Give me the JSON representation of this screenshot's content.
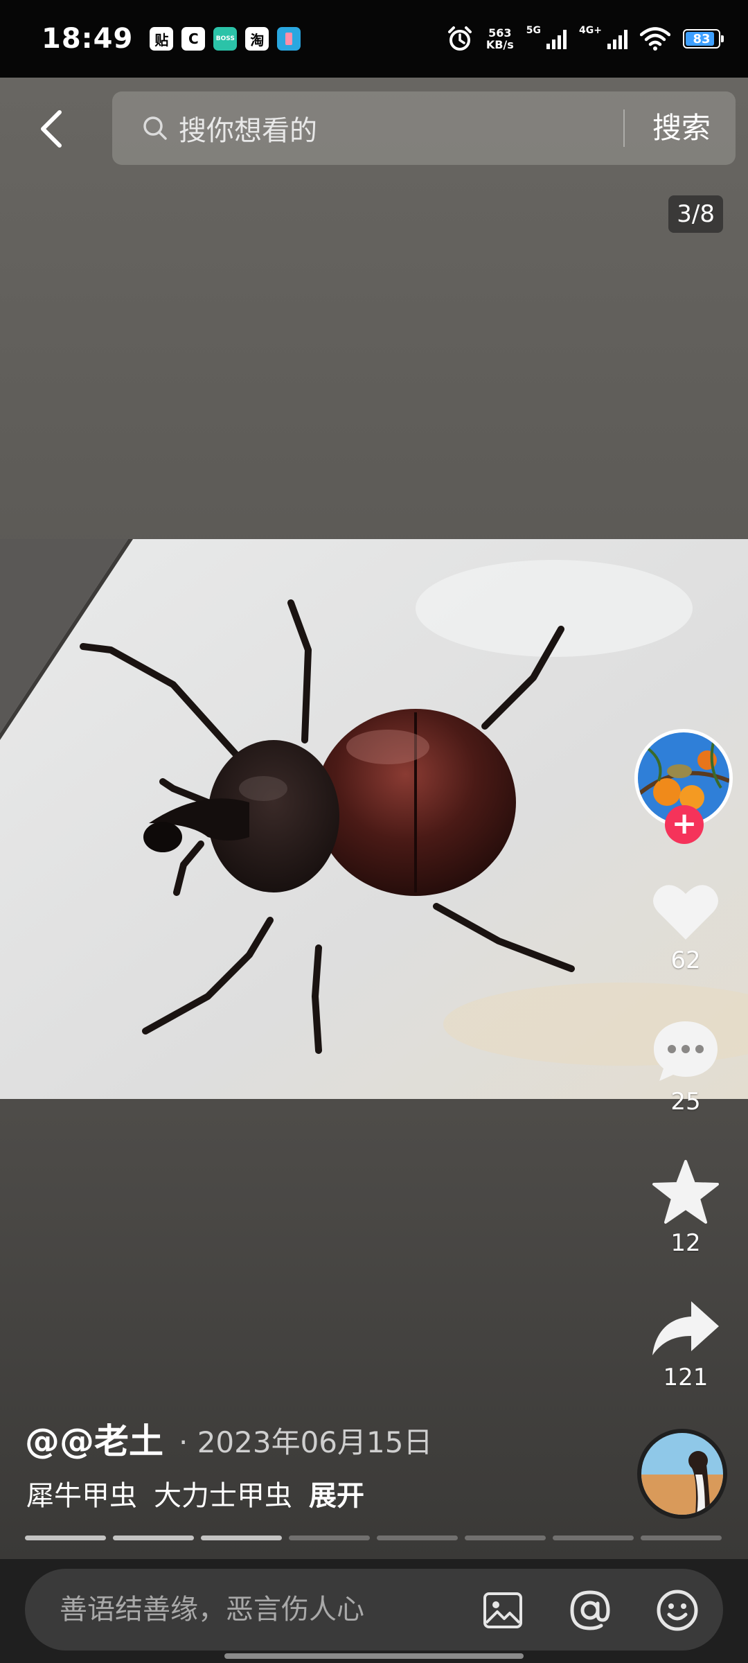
{
  "status_bar": {
    "time": "18:49",
    "app_icons": [
      {
        "name": "tieba-icon",
        "label": "贴",
        "color": "#ffffff"
      },
      {
        "name": "c-app-icon",
        "label": "C",
        "color": "#ffffff"
      },
      {
        "name": "boss-zhipin-icon",
        "label": "BOSS",
        "color": "#2bc3a8"
      },
      {
        "name": "taobao-icon",
        "label": "淘",
        "color": "#ffffff"
      },
      {
        "name": "app-icon",
        "label": "",
        "color": "#2aa7e0"
      }
    ],
    "net_speed": "563",
    "net_unit": "KB/s",
    "signal_1_label": "5G",
    "signal_2_label": "4G+",
    "battery": "83"
  },
  "search": {
    "placeholder": "搜你想看的",
    "button_label": "搜索"
  },
  "page_counter": "3/8",
  "actions": {
    "likes": "62",
    "comments": "25",
    "favorites": "12",
    "shares": "121"
  },
  "post": {
    "username": "@@老土",
    "date": "· 2023年06月15日",
    "tags": [
      "犀牛甲虫",
      "大力士甲虫"
    ],
    "expand_label": "展开"
  },
  "gallery": {
    "total": 8,
    "current": 3
  },
  "comment_bar": {
    "placeholder": "善语结善缘，恶言伤人心"
  },
  "colors": {
    "follow": "#f5335a",
    "battery": "#3ea0ff"
  }
}
